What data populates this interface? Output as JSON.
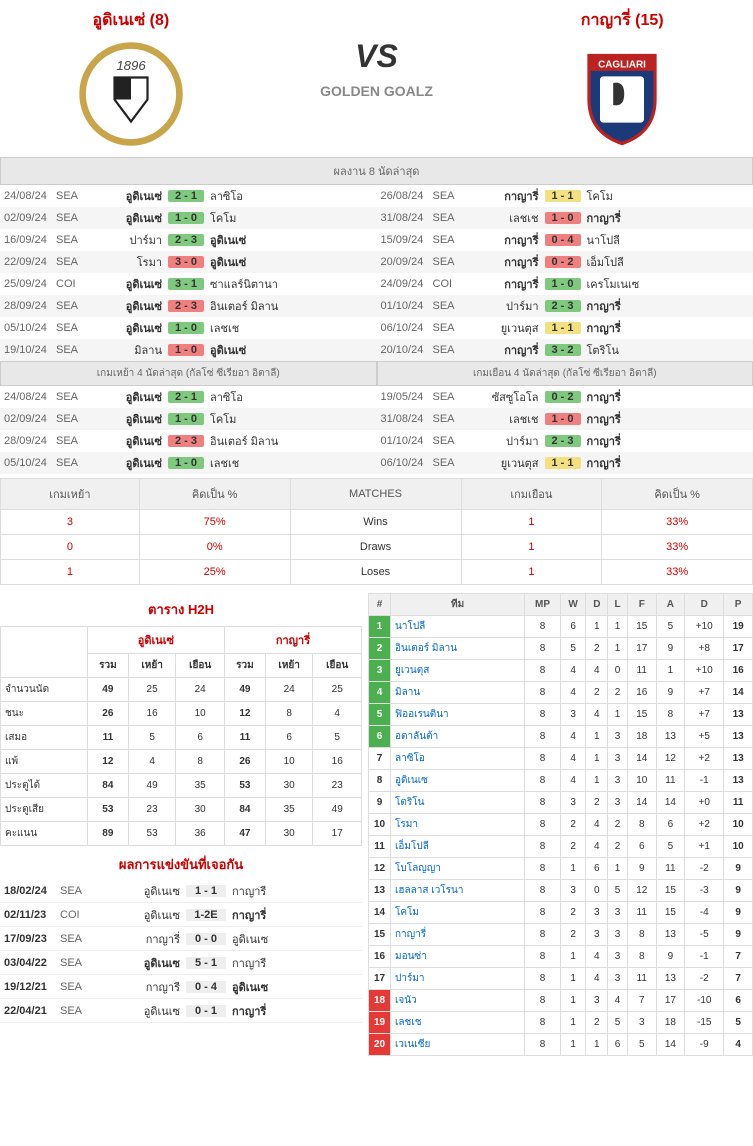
{
  "header": {
    "home_name": "อูดิเนเซ่ (8)",
    "away_name": "กาญารี่ (15)",
    "vs": "VS",
    "site": "GOLDEN GOALZ"
  },
  "sections": {
    "last8": "ผลงาน 8 นัดล่าสุด",
    "home4": "เกมเหย้า 4 นัดล่าสุด (กัลโซ่ ซีเรียอา อิตาลี)",
    "away4": "เกมเยือน 4 นัดล่าสุด (กัลโซ่ ซีเรียอา อิตาลี)"
  },
  "last8_home": [
    {
      "d": "24/08/24",
      "c": "SEA",
      "h": "อูดิเนเซ่",
      "hb": true,
      "s": "2 - 1",
      "sc": "sc-green",
      "a": "ลาซิโอ",
      "ab": false
    },
    {
      "d": "02/09/24",
      "c": "SEA",
      "h": "อูดิเนเซ่",
      "hb": true,
      "s": "1 - 0",
      "sc": "sc-green",
      "a": "โคโม",
      "ab": false
    },
    {
      "d": "16/09/24",
      "c": "SEA",
      "h": "ปาร์มา",
      "hb": false,
      "s": "2 - 3",
      "sc": "sc-green",
      "a": "อูดิเนเซ่",
      "ab": true
    },
    {
      "d": "22/09/24",
      "c": "SEA",
      "h": "โรมา",
      "hb": false,
      "s": "3 - 0",
      "sc": "sc-red",
      "a": "อูดิเนเซ่",
      "ab": true
    },
    {
      "d": "25/09/24",
      "c": "COI",
      "h": "อูดิเนเซ่",
      "hb": true,
      "s": "3 - 1",
      "sc": "sc-green",
      "a": "ซาแลร์นิตานา",
      "ab": false
    },
    {
      "d": "28/09/24",
      "c": "SEA",
      "h": "อูดิเนเซ่",
      "hb": true,
      "s": "2 - 3",
      "sc": "sc-red",
      "a": "อินเตอร์ มิลาน",
      "ab": false
    },
    {
      "d": "05/10/24",
      "c": "SEA",
      "h": "อูดิเนเซ่",
      "hb": true,
      "s": "1 - 0",
      "sc": "sc-green",
      "a": "เลชเช",
      "ab": false
    },
    {
      "d": "19/10/24",
      "c": "SEA",
      "h": "มิลาน",
      "hb": false,
      "s": "1 - 0",
      "sc": "sc-red",
      "a": "อูดิเนเซ่",
      "ab": true
    }
  ],
  "last8_away": [
    {
      "d": "26/08/24",
      "c": "SEA",
      "h": "กาญารี่",
      "hb": true,
      "s": "1 - 1",
      "sc": "sc-yellow",
      "a": "โคโม",
      "ab": false
    },
    {
      "d": "31/08/24",
      "c": "SEA",
      "h": "เลชเช",
      "hb": false,
      "s": "1 - 0",
      "sc": "sc-red",
      "a": "กาญารี่",
      "ab": true
    },
    {
      "d": "15/09/24",
      "c": "SEA",
      "h": "กาญารี่",
      "hb": true,
      "s": "0 - 4",
      "sc": "sc-red",
      "a": "นาโปลี",
      "ab": false
    },
    {
      "d": "20/09/24",
      "c": "SEA",
      "h": "กาญารี่",
      "hb": true,
      "s": "0 - 2",
      "sc": "sc-red",
      "a": "เอ็มโปลี",
      "ab": false
    },
    {
      "d": "24/09/24",
      "c": "COI",
      "h": "กาญารี่",
      "hb": true,
      "s": "1 - 0",
      "sc": "sc-green",
      "a": "เครโมเนเซ",
      "ab": false
    },
    {
      "d": "01/10/24",
      "c": "SEA",
      "h": "ปาร์มา",
      "hb": false,
      "s": "2 - 3",
      "sc": "sc-green",
      "a": "กาญารี่",
      "ab": true
    },
    {
      "d": "06/10/24",
      "c": "SEA",
      "h": "ยูเวนตุส",
      "hb": false,
      "s": "1 - 1",
      "sc": "sc-yellow",
      "a": "กาญารี่",
      "ab": true
    },
    {
      "d": "20/10/24",
      "c": "SEA",
      "h": "กาญารี่",
      "hb": true,
      "s": "3 - 2",
      "sc": "sc-green",
      "a": "โตริโน",
      "ab": false
    }
  ],
  "home4": [
    {
      "d": "24/08/24",
      "c": "SEA",
      "h": "อูดิเนเซ่",
      "hb": true,
      "s": "2 - 1",
      "sc": "sc-green",
      "a": "ลาซิโอ",
      "ab": false
    },
    {
      "d": "02/09/24",
      "c": "SEA",
      "h": "อูดิเนเซ่",
      "hb": true,
      "s": "1 - 0",
      "sc": "sc-green",
      "a": "โคโม",
      "ab": false
    },
    {
      "d": "28/09/24",
      "c": "SEA",
      "h": "อูดิเนเซ่",
      "hb": true,
      "s": "2 - 3",
      "sc": "sc-red",
      "a": "อินเตอร์ มิลาน",
      "ab": false
    },
    {
      "d": "05/10/24",
      "c": "SEA",
      "h": "อูดิเนเซ่",
      "hb": true,
      "s": "1 - 0",
      "sc": "sc-green",
      "a": "เลชเช",
      "ab": false
    }
  ],
  "away4": [
    {
      "d": "19/05/24",
      "c": "SEA",
      "h": "ซัสซูโอโล",
      "hb": false,
      "s": "0 - 2",
      "sc": "sc-green",
      "a": "กาญารี่",
      "ab": true
    },
    {
      "d": "31/08/24",
      "c": "SEA",
      "h": "เลชเช",
      "hb": false,
      "s": "1 - 0",
      "sc": "sc-red",
      "a": "กาญารี่",
      "ab": true
    },
    {
      "d": "01/10/24",
      "c": "SEA",
      "h": "ปาร์มา",
      "hb": false,
      "s": "2 - 3",
      "sc": "sc-green",
      "a": "กาญารี่",
      "ab": true
    },
    {
      "d": "06/10/24",
      "c": "SEA",
      "h": "ยูเวนตุส",
      "hb": false,
      "s": "1 - 1",
      "sc": "sc-yellow",
      "a": "กาญารี่",
      "ab": true
    }
  ],
  "stats": {
    "headers": {
      "home_games": "เกมเหย้า",
      "pct": "คิดเป็น %",
      "matches": "MATCHES",
      "away_games": "เกมเยือน"
    },
    "rows": [
      {
        "hg": "3",
        "hp": "75%",
        "label": "Wins",
        "ag": "1",
        "ap": "33%"
      },
      {
        "hg": "0",
        "hp": "0%",
        "label": "Draws",
        "ag": "1",
        "ap": "33%"
      },
      {
        "hg": "1",
        "hp": "25%",
        "label": "Loses",
        "ag": "1",
        "ap": "33%"
      }
    ]
  },
  "h2h": {
    "title": "ตาราง H2H",
    "team1": "อูดิเนเซ่",
    "team2": "กาญารี่",
    "cols": [
      "รวม",
      "เหย้า",
      "เยือน",
      "รวม",
      "เหย้า",
      "เยือน"
    ],
    "rows": [
      {
        "label": "จำนวนนัด",
        "v": [
          "49",
          "25",
          "24",
          "49",
          "24",
          "25"
        ]
      },
      {
        "label": "ชนะ",
        "v": [
          "26",
          "16",
          "10",
          "12",
          "8",
          "4"
        ]
      },
      {
        "label": "เสมอ",
        "v": [
          "11",
          "5",
          "6",
          "11",
          "6",
          "5"
        ]
      },
      {
        "label": "แพ้",
        "v": [
          "12",
          "4",
          "8",
          "26",
          "10",
          "16"
        ]
      },
      {
        "label": "ประตูได้",
        "v": [
          "84",
          "49",
          "35",
          "53",
          "30",
          "23"
        ]
      },
      {
        "label": "ประตูเสีย",
        "v": [
          "53",
          "23",
          "30",
          "84",
          "35",
          "49"
        ]
      },
      {
        "label": "คะแนน",
        "v": [
          "89",
          "53",
          "36",
          "47",
          "30",
          "17"
        ]
      }
    ]
  },
  "h2h_matches": {
    "title": "ผลการแข่งขันที่เจอกัน",
    "rows": [
      {
        "d": "18/02/24",
        "c": "SEA",
        "h": "อูดิเนเซ",
        "hb": false,
        "s": "1 - 1",
        "a": "กาญารี",
        "ab": false
      },
      {
        "d": "02/11/23",
        "c": "COI",
        "h": "อูดิเนเซ",
        "hb": false,
        "s": "1-2E",
        "a": "กาญารี่",
        "ab": true
      },
      {
        "d": "17/09/23",
        "c": "SEA",
        "h": "กาญารี่",
        "hb": false,
        "s": "0 - 0",
        "a": "อูดิเนเซ",
        "ab": false
      },
      {
        "d": "03/04/22",
        "c": "SEA",
        "h": "อูดิเนเซ",
        "hb": true,
        "s": "5 - 1",
        "a": "กาญารี",
        "ab": false
      },
      {
        "d": "19/12/21",
        "c": "SEA",
        "h": "กาญารี",
        "hb": false,
        "s": "0 - 4",
        "a": "อูดิเนเซ",
        "ab": true
      },
      {
        "d": "22/04/21",
        "c": "SEA",
        "h": "อูดิเนเซ",
        "hb": false,
        "s": "0 - 1",
        "a": "กาญารี่",
        "ab": true
      }
    ]
  },
  "standings": {
    "headers": [
      "#",
      "ทีม",
      "MP",
      "W",
      "D",
      "L",
      "F",
      "A",
      "D",
      "P"
    ],
    "rows": [
      {
        "pos": "1",
        "pc": "pos-green",
        "team": "นาโปลี",
        "v": [
          "8",
          "6",
          "1",
          "1",
          "15",
          "5",
          "+10",
          "19"
        ]
      },
      {
        "pos": "2",
        "pc": "pos-green",
        "team": "อินเตอร์ มิลาน",
        "v": [
          "8",
          "5",
          "2",
          "1",
          "17",
          "9",
          "+8",
          "17"
        ]
      },
      {
        "pos": "3",
        "pc": "pos-green",
        "team": "ยูเวนตุส",
        "v": [
          "8",
          "4",
          "4",
          "0",
          "11",
          "1",
          "+10",
          "16"
        ]
      },
      {
        "pos": "4",
        "pc": "pos-green",
        "team": "มิลาน",
        "v": [
          "8",
          "4",
          "2",
          "2",
          "16",
          "9",
          "+7",
          "14"
        ]
      },
      {
        "pos": "5",
        "pc": "pos-green",
        "team": "ฟิออเรนตินา",
        "v": [
          "8",
          "3",
          "4",
          "1",
          "15",
          "8",
          "+7",
          "13"
        ]
      },
      {
        "pos": "6",
        "pc": "pos-green",
        "team": "อตาลันต้า",
        "v": [
          "8",
          "4",
          "1",
          "3",
          "18",
          "13",
          "+5",
          "13"
        ]
      },
      {
        "pos": "7",
        "pc": "",
        "team": "ลาซิโอ",
        "v": [
          "8",
          "4",
          "1",
          "3",
          "14",
          "12",
          "+2",
          "13"
        ]
      },
      {
        "pos": "8",
        "pc": "",
        "team": "อูดิเนเซ",
        "v": [
          "8",
          "4",
          "1",
          "3",
          "10",
          "11",
          "-1",
          "13"
        ]
      },
      {
        "pos": "9",
        "pc": "",
        "team": "โตริโน",
        "v": [
          "8",
          "3",
          "2",
          "3",
          "14",
          "14",
          "+0",
          "11"
        ]
      },
      {
        "pos": "10",
        "pc": "",
        "team": "โรมา",
        "v": [
          "8",
          "2",
          "4",
          "2",
          "8",
          "6",
          "+2",
          "10"
        ]
      },
      {
        "pos": "11",
        "pc": "",
        "team": "เอ็มโปลี",
        "v": [
          "8",
          "2",
          "4",
          "2",
          "6",
          "5",
          "+1",
          "10"
        ]
      },
      {
        "pos": "12",
        "pc": "",
        "team": "โบโลญญา",
        "v": [
          "8",
          "1",
          "6",
          "1",
          "9",
          "11",
          "-2",
          "9"
        ]
      },
      {
        "pos": "13",
        "pc": "",
        "team": "เฮลลาส เวโรนา",
        "v": [
          "8",
          "3",
          "0",
          "5",
          "12",
          "15",
          "-3",
          "9"
        ]
      },
      {
        "pos": "14",
        "pc": "",
        "team": "โคโม",
        "v": [
          "8",
          "2",
          "3",
          "3",
          "11",
          "15",
          "-4",
          "9"
        ]
      },
      {
        "pos": "15",
        "pc": "",
        "team": "กาญารี่",
        "v": [
          "8",
          "2",
          "3",
          "3",
          "8",
          "13",
          "-5",
          "9"
        ]
      },
      {
        "pos": "16",
        "pc": "",
        "team": "มอนซ่า",
        "v": [
          "8",
          "1",
          "4",
          "3",
          "8",
          "9",
          "-1",
          "7"
        ]
      },
      {
        "pos": "17",
        "pc": "",
        "team": "ปาร์มา",
        "v": [
          "8",
          "1",
          "4",
          "3",
          "11",
          "13",
          "-2",
          "7"
        ]
      },
      {
        "pos": "18",
        "pc": "pos-red",
        "team": "เจนัว",
        "v": [
          "8",
          "1",
          "3",
          "4",
          "7",
          "17",
          "-10",
          "6"
        ]
      },
      {
        "pos": "19",
        "pc": "pos-red",
        "team": "เลชเช",
        "v": [
          "8",
          "1",
          "2",
          "5",
          "3",
          "18",
          "-15",
          "5"
        ]
      },
      {
        "pos": "20",
        "pc": "pos-red",
        "team": "เวเนเซีย",
        "v": [
          "8",
          "1",
          "1",
          "6",
          "5",
          "14",
          "-9",
          "4"
        ]
      }
    ]
  }
}
